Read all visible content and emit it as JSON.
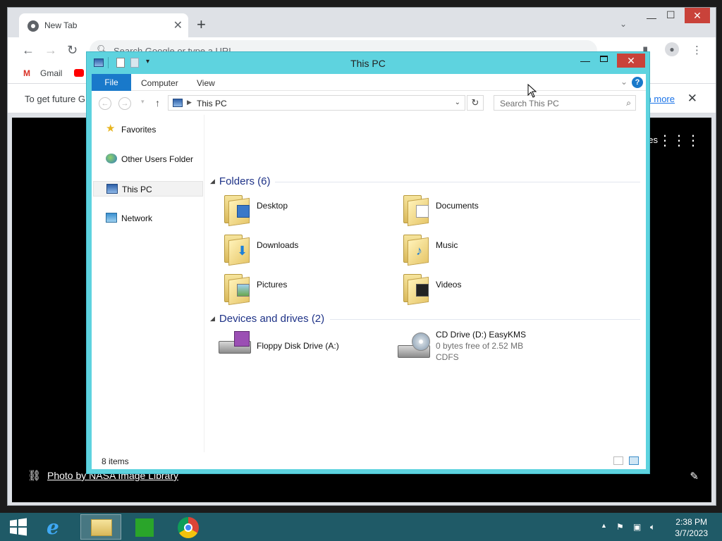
{
  "chrome": {
    "tab_title": "New Tab",
    "tab_close": "✕",
    "newtab": "+",
    "omnibox_placeholder": "Search Google or type a URL",
    "bookmarks": [
      "Gmail"
    ],
    "infobar_text": "To get future G",
    "infobar_link": "n more",
    "infobar_close": "✕",
    "ntp_images": "ges",
    "ntp_credit": "Photo by NASA Image Library"
  },
  "explorer": {
    "title": "This PC",
    "ribbon_tabs": {
      "file": "File",
      "computer": "Computer",
      "view": "View"
    },
    "address": "This PC",
    "search_placeholder": "Search This PC",
    "nav": {
      "favorites": "Favorites",
      "other_users": "Other Users Folder",
      "this_pc": "This PC",
      "network": "Network"
    },
    "folders_header": "Folders (6)",
    "folders": [
      "Desktop",
      "Documents",
      "Downloads",
      "Music",
      "Pictures",
      "Videos"
    ],
    "devices_header": "Devices and drives (2)",
    "devices": {
      "floppy": "Floppy Disk Drive (A:)",
      "cd_name": "CD Drive (D:) EasyKMS",
      "cd_free": "0 bytes free of 2.52 MB",
      "cd_fs": "CDFS"
    },
    "status": "8 items"
  },
  "taskbar": {
    "time": "2:38 PM",
    "date": "3/7/2023"
  }
}
